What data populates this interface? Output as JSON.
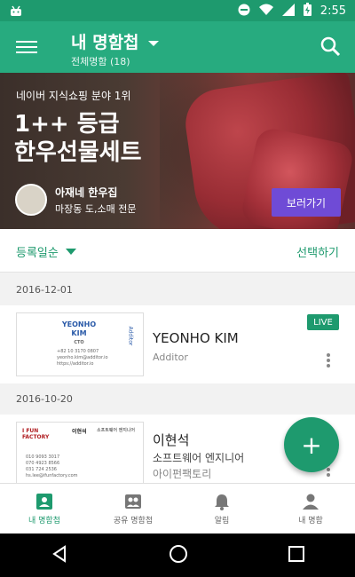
{
  "statusbar": {
    "time": "2:55"
  },
  "appbar": {
    "title": "내 명함첩",
    "subtitle": "전체명함 (18)"
  },
  "banner": {
    "tagline": "네이버 지식쇼핑 분야 1위",
    "headline_line1": "1++ 등급",
    "headline_line2": "한우선물세트",
    "shop_name": "아재네 한우집",
    "shop_desc": "마장동 도,소매 전문",
    "button_label": "보러가기"
  },
  "sortbar": {
    "sort_label": "등록일순",
    "select_label": "선택하기"
  },
  "cards": [
    {
      "date": "2016-12-01",
      "name": "YEONHO KIM",
      "company": "Additor",
      "badge": "LIVE",
      "thumb": {
        "line1": "YEONHO",
        "line2": "KIM",
        "line3": "CTO",
        "small1": "+82 10 3170 0807",
        "small2": "yeonho.kim@additor.io",
        "small3": "https://additor.io",
        "logo": "Additor"
      }
    },
    {
      "date": "2016-10-20",
      "name": "이현석",
      "title": "소프트웨어 엔지니어",
      "company": "아이펀팩토리",
      "thumb": {
        "line1": "이현석",
        "line2": "소프트웨어 엔지니어",
        "logo": "I FUN FACTORY",
        "small1": "010 9093 3017",
        "small2": "070 4923 8566",
        "small3": "031 724 2536",
        "small4": "hs.lee@ifunfactory.com"
      }
    }
  ],
  "bottomnav": {
    "items": [
      {
        "label": "내 명함첩"
      },
      {
        "label": "공유 명함첩"
      },
      {
        "label": "알림"
      },
      {
        "label": "내 명함"
      }
    ]
  },
  "fab": {
    "label": "+"
  },
  "colors": {
    "primary": "#27ab7f",
    "primary_dark": "#1e9a6e",
    "banner_button": "#6f4bd6"
  }
}
